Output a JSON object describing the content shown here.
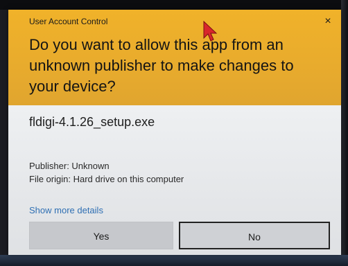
{
  "dialog": {
    "title": "User Account Control",
    "close_glyph": "×",
    "question": "Do you want to allow this app from an unknown publisher to make changes to your device?",
    "app_name": "fldigi-4.1.26_setup.exe",
    "publisher": "Publisher: Unknown",
    "file_origin": "File origin: Hard drive on this computer",
    "more_details_link": "Show more details",
    "yes_label": "Yes",
    "no_label": "No"
  },
  "colors": {
    "header_accent": "#f0b22a",
    "link": "#2f6fb3",
    "cursor": "#d8262b"
  },
  "icons": [
    "close-icon",
    "mouse-pointer-icon"
  ]
}
